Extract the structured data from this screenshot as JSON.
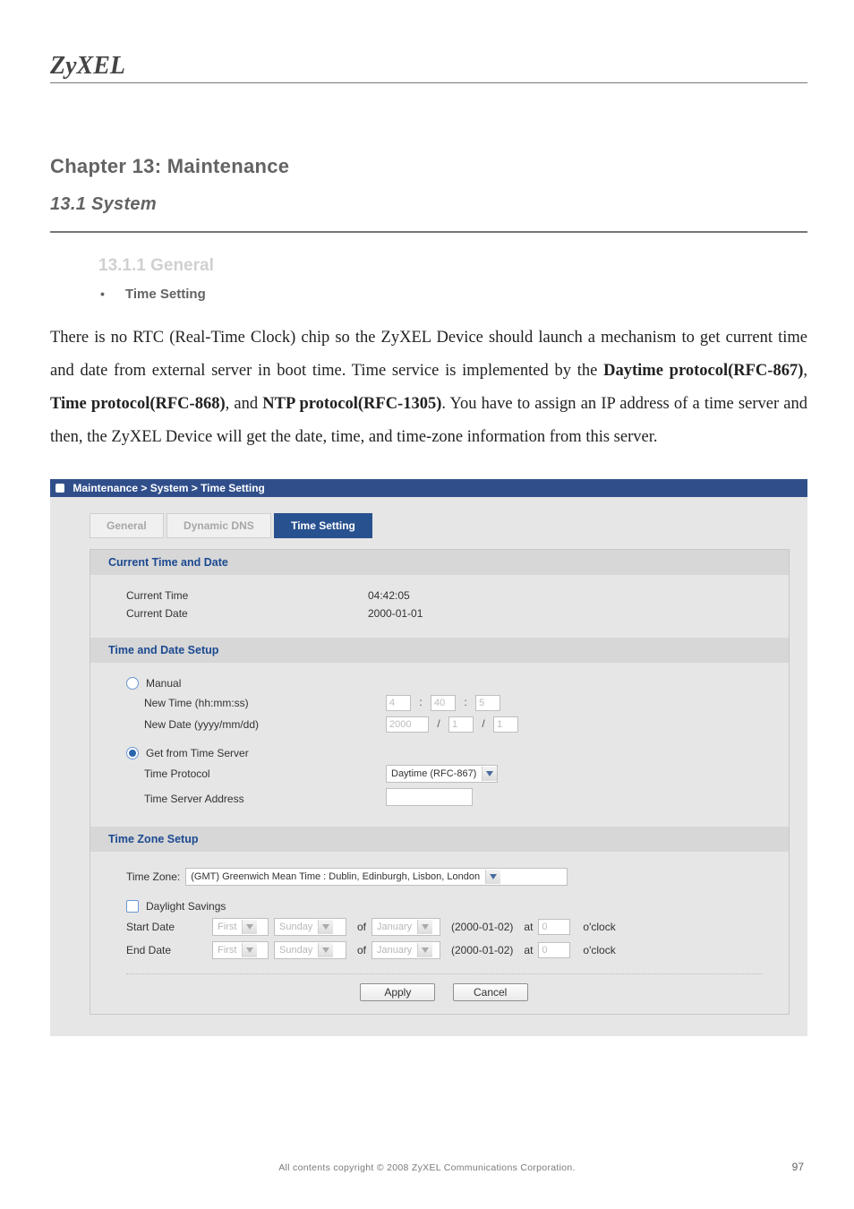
{
  "brand": "ZyXEL",
  "chapter": "Chapter 13: Maintenance",
  "section": "13.1 System",
  "subsection": "13.1.1 General",
  "bullet": "Time Setting",
  "intro_html": "There is no RTC (Real-Time Clock) chip so the ZyXEL Device should launch a mechanism to get current time and date from external server in boot time. Time service is implemented by the <b>Daytime protocol(RFC-867)</b>, <b>Time protocol(RFC-868)</b>, and <b>NTP protocol(RFC-1305)</b>. You have to assign an IP address of a time server and then, the ZyXEL Device will get the date, time, and time-zone information from this server.",
  "breadcrumb": "Maintenance > System > Time Setting",
  "tabs": {
    "general": "General",
    "ddns": "Dynamic DNS",
    "time": "Time Setting"
  },
  "sections": {
    "current": "Current Time and Date",
    "setup": "Time and Date Setup",
    "tz": "Time Zone Setup"
  },
  "current": {
    "time_label": "Current Time",
    "time_value": "04:42:05",
    "date_label": "Current Date",
    "date_value": "2000-01-01"
  },
  "mode": {
    "manual": {
      "label": "Manual",
      "checked": false,
      "newtime_label": "New Time (hh:mm:ss)",
      "newtime": {
        "hh": "4",
        "mm": "40",
        "ss": "5"
      },
      "newdate_label": "New Date (yyyy/mm/dd)",
      "newdate": {
        "y": "2000",
        "m": "1",
        "d": "1"
      }
    },
    "server": {
      "label": "Get from Time Server",
      "checked": true,
      "protocol_label": "Time Protocol",
      "protocol_value": "Daytime (RFC-867)",
      "address_label": "Time Server Address",
      "address_value": ""
    }
  },
  "tz": {
    "label": "Time Zone:",
    "value": "(GMT) Greenwich Mean Time : Dublin, Edinburgh, Lisbon, London"
  },
  "daylight": {
    "label": "Daylight Savings",
    "checked": false,
    "of": "of",
    "at": "at",
    "oclock": "o'clock",
    "start": {
      "label": "Start Date",
      "ord": "First",
      "day": "Sunday",
      "month": "January",
      "date": "(2000-01-02)",
      "hour": "0"
    },
    "end": {
      "label": "End Date",
      "ord": "First",
      "day": "Sunday",
      "month": "January",
      "date": "(2000-01-02)",
      "hour": "0"
    }
  },
  "buttons": {
    "apply": "Apply",
    "cancel": "Cancel"
  },
  "footer": "All contents copyright © 2008 ZyXEL Communications Corporation.",
  "page_number": "97"
}
